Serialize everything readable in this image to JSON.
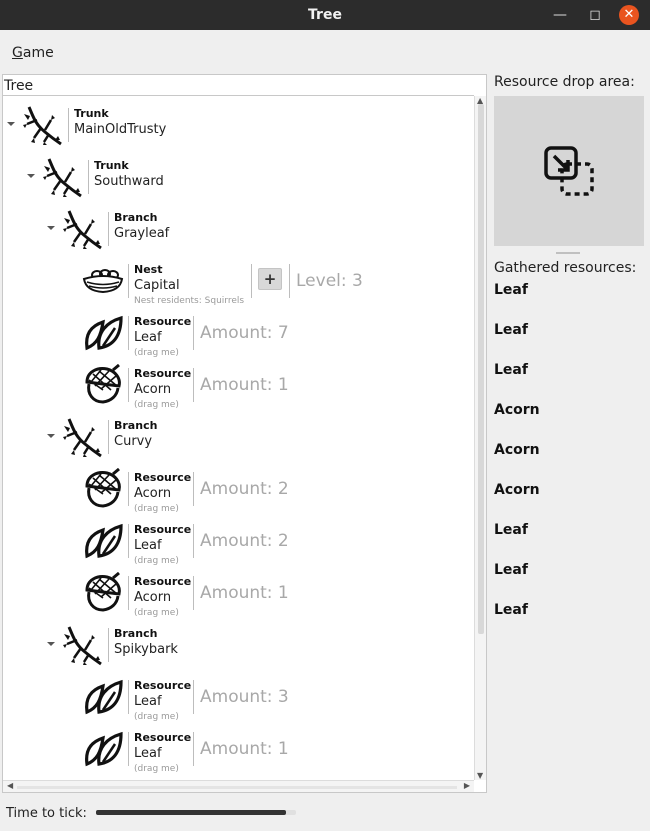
{
  "window": {
    "title": "Tree"
  },
  "menu": {
    "game_prefix": "G",
    "game_rest": "ame"
  },
  "tree": {
    "header": "Tree",
    "rows": [
      {
        "kind": "Trunk",
        "name": "MainOldTrusty",
        "icon": "twig-icon",
        "expander": true
      },
      {
        "kind": "Trunk",
        "name": "Southward",
        "icon": "twig-icon",
        "expander": true
      },
      {
        "kind": "Branch",
        "name": "Grayleaf",
        "icon": "twig-icon",
        "expander": true
      },
      {
        "kind": "Nest",
        "name": "Capital",
        "icon": "nest-icon",
        "hint": "Nest residents: Squirrels",
        "button": "+",
        "level": "Level: 3"
      },
      {
        "kind": "Resource",
        "name": "Leaf",
        "icon": "leaf-icon",
        "hint": "(drag me)",
        "amount": "Amount: 7"
      },
      {
        "kind": "Resource",
        "name": "Acorn",
        "icon": "acorn-icon",
        "hint": "(drag me)",
        "amount": "Amount: 1"
      },
      {
        "kind": "Branch",
        "name": "Curvy",
        "icon": "twig-icon",
        "expander": true
      },
      {
        "kind": "Resource",
        "name": "Acorn",
        "icon": "acorn-icon",
        "hint": "(drag me)",
        "amount": "Amount: 2"
      },
      {
        "kind": "Resource",
        "name": "Leaf",
        "icon": "leaf-icon",
        "hint": "(drag me)",
        "amount": "Amount: 2"
      },
      {
        "kind": "Resource",
        "name": "Acorn",
        "icon": "acorn-icon",
        "hint": "(drag me)",
        "amount": "Amount: 1"
      },
      {
        "kind": "Branch",
        "name": "Spikybark",
        "icon": "twig-icon",
        "expander": true
      },
      {
        "kind": "Resource",
        "name": "Leaf",
        "icon": "leaf-icon",
        "hint": "(drag me)",
        "amount": "Amount: 3"
      },
      {
        "kind": "Resource",
        "name": "Leaf",
        "icon": "leaf-icon",
        "hint": "(drag me)",
        "amount": "Amount: 1"
      }
    ]
  },
  "drop_area": {
    "label": "Resource drop area:",
    "icon": "drop-target-icon"
  },
  "gathered": {
    "label": "Gathered resources:",
    "items": [
      "Leaf",
      "Leaf",
      "Leaf",
      "Acorn",
      "Acorn",
      "Acorn",
      "Leaf",
      "Leaf",
      "Leaf"
    ]
  },
  "status": {
    "label": "Time to tick:",
    "progress": 0.95
  }
}
